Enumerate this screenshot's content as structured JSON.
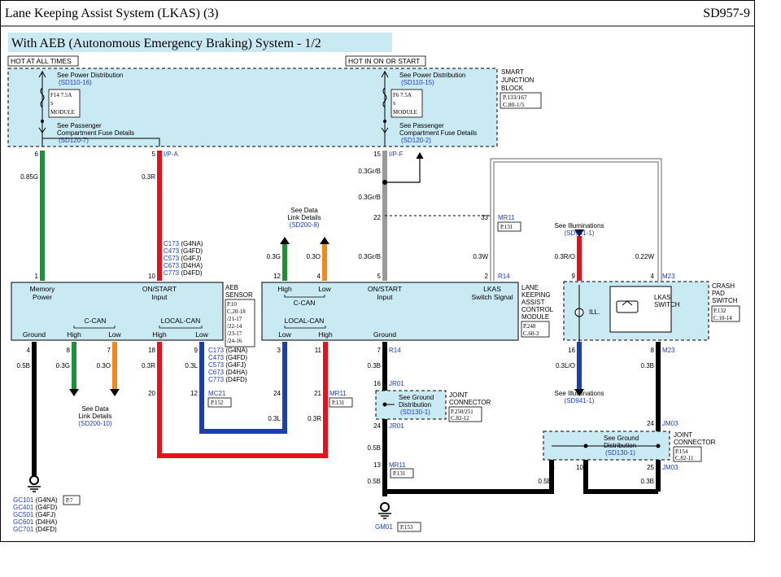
{
  "header": {
    "title": "Lane Keeping Assist System (LKAS) (3)",
    "page_code": "SD957-9"
  },
  "subtitle": "With AEB (Autonomous Emergency Braking) System - 1/2",
  "power": {
    "hot_all": "HOT AT ALL TIMES",
    "hot_on": "HOT IN ON OR START"
  },
  "sjb": {
    "name1": "SMART",
    "name2": "JUNCTION",
    "name3": "BLOCK",
    "ref1": "P.133/167",
    "ref2": "C.80-1/5",
    "see_power": "See Power Distribution",
    "ref_left": "(SD110-16)",
    "ref_right": "(SD110-15)",
    "fuse_left": "F14 7.5A",
    "fuse_right": "F6 7.5A",
    "fuse_sub": "S",
    "fuse_module": "MODULE",
    "see_pass1": "See Passenger",
    "see_pass2": "Compartment Fuse Details",
    "pass_left": "(SD120-7)",
    "pass_right": "(SD120-2)"
  },
  "pins": {
    "p6": "6",
    "p5": "5",
    "p15": "15",
    "p22": "22",
    "p33": "33",
    "p1": "1",
    "p10": "10",
    "p12": "12",
    "p4": "4",
    "p5b": "5",
    "p2": "2",
    "p9": "9",
    "p4b": "4",
    "p4c": "4",
    "p8": "8",
    "p7": "7",
    "p18": "18",
    "p9b": "9",
    "p3": "3",
    "p11": "11",
    "p7b": "7",
    "p20": "20",
    "p12b": "12",
    "p24": "24",
    "p21": "21",
    "p16": "16",
    "p24b": "24",
    "p13": "13",
    "p16b": "16",
    "p8b": "8",
    "p24c": "24",
    "p25": "25",
    "p4d": "4",
    "p10b": "10"
  },
  "connectors": {
    "ipa": "I/P-A",
    "ipf": "I/P-F",
    "mr11": "MR11",
    "r14": "R14",
    "r14b": "R14",
    "m23": "M23",
    "m23b": "M23",
    "mc21": "MC21",
    "mr11b": "MR11",
    "jr01": "JR01",
    "jr01b": "JR01",
    "mr11c": "MR11",
    "jm03": "JM03",
    "jm03b": "JM03",
    "gm01": "GM01"
  },
  "refs": {
    "mr11": "P.131",
    "mc21": "P.152",
    "mr11b": "P.131",
    "mr11c": "P.131",
    "gm01": "P.153",
    "gc": "P.7"
  },
  "wires": {
    "w1": "0.85G",
    "w2": "0.3R",
    "w3": "0.3Gr/B",
    "w4": "0.3Gr/B",
    "w5": "0.3Gr/B",
    "w6": "0.3G",
    "w7": "0.3O",
    "w8": "0.3W",
    "w9": "0.3R/O",
    "w10": "0.22W",
    "w11": "0.5B",
    "w12": "0.3G",
    "w13": "0.3O",
    "w14": "0.3R",
    "w15": "0.3L",
    "w16": "0.3L",
    "w17": "0.3R",
    "w18": "0.3B",
    "w19": "0.3L/O",
    "w20": "0.3B",
    "w21": "0.5B",
    "w22": "0.5B",
    "w23": "0.5B",
    "w24": "0.3B"
  },
  "data_link_top": {
    "l1": "See Data",
    "l2": "Link Details",
    "ref": "(SD200-8)"
  },
  "data_link_bottom": {
    "l1": "See Data",
    "l2": "Link Details",
    "ref": "(SD200-10)"
  },
  "illum_top": {
    "l1": "See Illuminations",
    "ref": "(SD941-1)"
  },
  "illum_bottom": {
    "l1": "See Illuminations",
    "ref": "(SD941-1)"
  },
  "aeb_codes": [
    {
      "code": "C173",
      "eng": "(G4NA)"
    },
    {
      "code": "C473",
      "eng": "(G4FD)"
    },
    {
      "code": "C573",
      "eng": "(G4FJ)"
    },
    {
      "code": "C673",
      "eng": "(D4HA)"
    },
    {
      "code": "C773",
      "eng": "(D4FD)"
    }
  ],
  "aeb_codes2": [
    {
      "code": "C173",
      "eng": "(G4NA)"
    },
    {
      "code": "C473",
      "eng": "(G4FD)"
    },
    {
      "code": "C573",
      "eng": "(G4FJ)"
    },
    {
      "code": "C673",
      "eng": "(D4HA)"
    },
    {
      "code": "C773",
      "eng": "(D4FD)"
    }
  ],
  "aeb": {
    "name1": "AEB",
    "name2": "SENSOR",
    "refs": [
      "P.10",
      "C.20-18",
      "/21-17",
      "/22-14",
      "/23-17",
      "/24-16"
    ],
    "memory": "Memory",
    "power": "Power",
    "onstart": "ON/START",
    "input": "Input",
    "ccan": "C-CAN",
    "localcan": "LOCAL-CAN",
    "ground": "Ground",
    "high1": "High",
    "low1": "Low",
    "high2": "High",
    "low2": "Low"
  },
  "lkas": {
    "name1": "LANE",
    "name2": "KEEPING",
    "name3": "ASSIST",
    "name4": "CONTROL",
    "name5": "MODULE",
    "ref1": "P.248",
    "ref2": "C.60-3",
    "high": "High",
    "low": "Low",
    "ccan": "C-CAN",
    "onstart": "ON/START",
    "input": "Input",
    "sw1": "LKAS",
    "sw2": "Switch Signal",
    "localcan": "LOCAL-CAN",
    "low2": "Low",
    "high2": "High",
    "ground": "Ground"
  },
  "crash": {
    "name1": "CRASH",
    "name2": "PAD",
    "name3": "SWITCH",
    "ref1": "P.132",
    "ref2": "C.10-14",
    "ill": "ILL.",
    "sw1": "LKAS",
    "sw2": "SWITCH"
  },
  "jr01_joint": {
    "l1": "See Ground",
    "l2": "Distribution",
    "ref": "(SD130-1)",
    "name1": "JOINT",
    "name2": "CONNECTOR",
    "ref1": "P.250/251",
    "ref2": "C.82-12"
  },
  "jm03_joint": {
    "l1": "See Ground",
    "l2": "Distribution",
    "ref": "(SD130-1)",
    "name1": "JOINT",
    "name2": "CONNECTOR",
    "ref1": "P.154",
    "ref2": "C.82-11"
  },
  "ground_codes": [
    {
      "code": "GC101",
      "eng": "(G4NA)"
    },
    {
      "code": "GC401",
      "eng": "(G4FD)"
    },
    {
      "code": "GC501",
      "eng": "(G4FJ)"
    },
    {
      "code": "GC601",
      "eng": "(D4HA)"
    },
    {
      "code": "GC701",
      "eng": "(D4FD)"
    }
  ],
  "colors": {
    "green": "#1f8f3a",
    "red": "#e0141e",
    "orange": "#f08a1e",
    "blue": "#1f3fa8",
    "gray": "#9a9a9a",
    "black": "#000000",
    "panel": "#c9e9f3"
  }
}
